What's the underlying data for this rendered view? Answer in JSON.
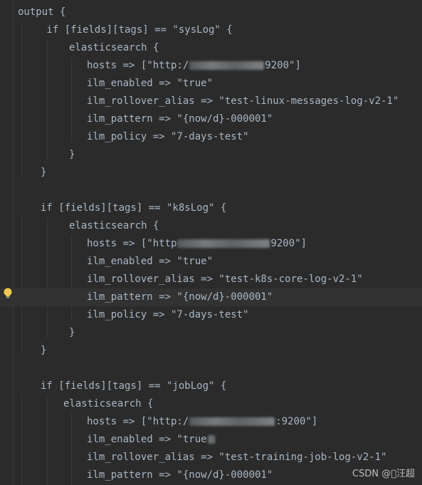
{
  "editor": {
    "background": "#2b2b2b",
    "text_color": "#a9b7c6",
    "current_line_color": "#323232",
    "lines": [
      {
        "text": "output {"
      },
      {
        "text": " if [fields][tags] == \"sysLog\" {"
      },
      {
        "text": "elasticsearch {"
      },
      {
        "pre": "hosts => [\"http:/",
        "post": "9200\"]"
      },
      {
        "text": "ilm_enabled => \"true\""
      },
      {
        "text": "ilm_rollover_alias => \"test-linux-messages-log-v2-1\""
      },
      {
        "text": "ilm_pattern => \"{now/d}-000001\""
      },
      {
        "text": "ilm_policy => \"7-days-test\""
      },
      {
        "text": "}"
      },
      {
        "text": "}"
      },
      {
        "text": ""
      },
      {
        "text": "if [fields][tags] == \"k8sLog\" {"
      },
      {
        "text": "elasticsearch {"
      },
      {
        "pre": "hosts => [\"http",
        "post": "9200\"]"
      },
      {
        "text": "ilm_enabled => \"true\""
      },
      {
        "text": "ilm_rollover_alias => \"test-k8s-core-log-v2-1\""
      },
      {
        "text": "ilm_pattern => \"{now/d}-000001\""
      },
      {
        "text": "ilm_policy => \"7-days-test\""
      },
      {
        "text": "}"
      },
      {
        "text": "}"
      },
      {
        "text": ""
      },
      {
        "text": "if [fields][tags] == \"jobLog\" {"
      },
      {
        "text": "elasticsearch {"
      },
      {
        "pre": "hosts => [\"http:/",
        "post": ":9200\"]"
      },
      {
        "pre": "ilm_enabled => \"true",
        "post": ""
      },
      {
        "text": "ilm_rollover_alias => \"test-training-job-log-v2-1\""
      },
      {
        "text": "ilm_pattern => \"{now/d}-000001\""
      }
    ]
  },
  "watermark": "CSDN @\u0000汪超",
  "icons": {
    "intention_bulb": "lightbulb-icon"
  }
}
